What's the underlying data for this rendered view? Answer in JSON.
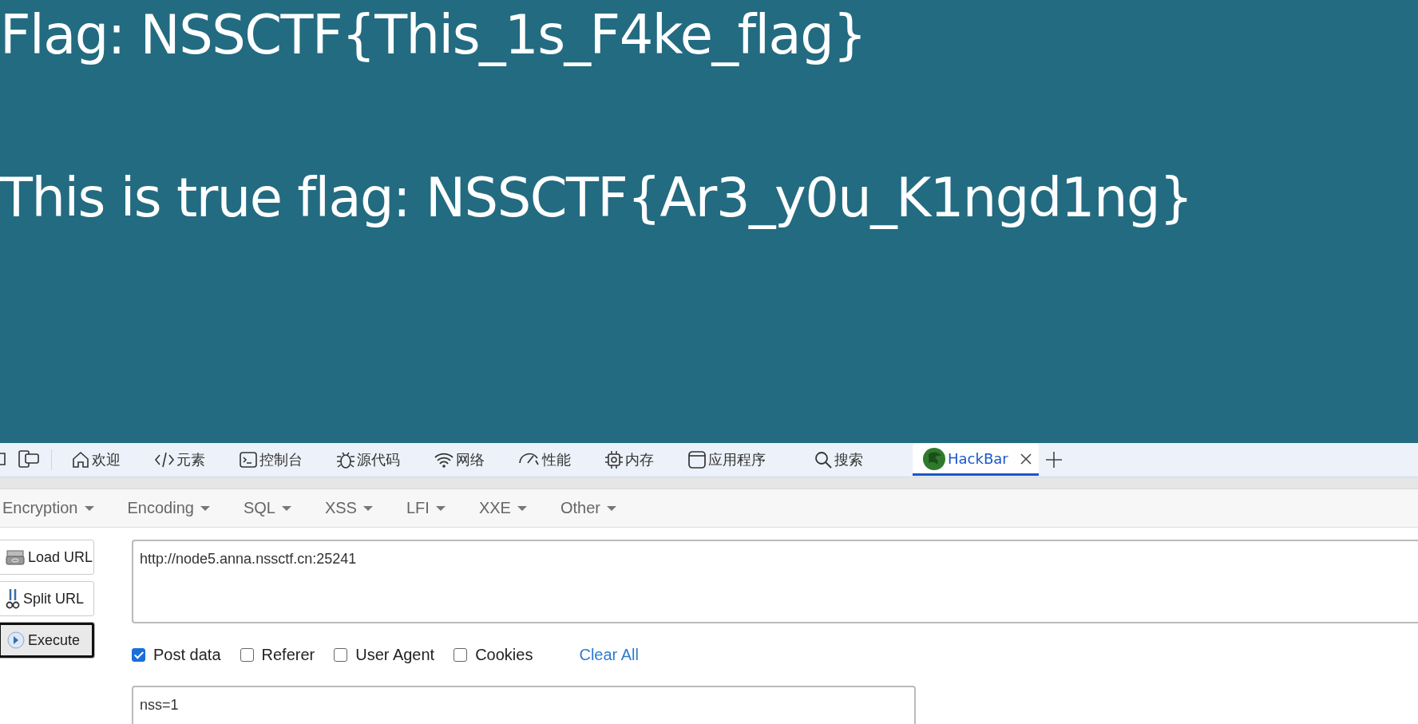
{
  "page": {
    "lines": [
      "Flag: NSSCTF{This_1s_F4ke_flag}",
      "This is true flag: NSSCTF{Ar3_y0u_K1ngd1ng}"
    ]
  },
  "devtools": {
    "tabs": [
      {
        "label": "欢迎",
        "selected": false
      },
      {
        "label": "元素",
        "selected": false
      },
      {
        "label": "控制台",
        "selected": false
      },
      {
        "label": "源代码",
        "selected": false
      },
      {
        "label": "网络",
        "selected": false
      },
      {
        "label": "性能",
        "selected": false
      },
      {
        "label": "内存",
        "selected": false
      },
      {
        "label": "应用程序",
        "selected": false
      },
      {
        "label": "搜索",
        "selected": false
      },
      {
        "label": "HackBar",
        "selected": true
      }
    ]
  },
  "hackbar": {
    "menus": [
      "Encryption",
      "Encoding",
      "SQL",
      "XSS",
      "LFI",
      "XXE",
      "Other"
    ],
    "buttons": [
      {
        "label": "Load URL",
        "focused": false
      },
      {
        "label": "Split URL",
        "focused": false
      },
      {
        "label": "Execute",
        "focused": true
      }
    ],
    "url": "http://node5.anna.nssctf.cn:25241",
    "options": [
      {
        "label": "Post data",
        "checked": true
      },
      {
        "label": "Referer",
        "checked": false
      },
      {
        "label": "User Agent",
        "checked": false
      },
      {
        "label": "Cookies",
        "checked": false
      }
    ],
    "clear_all": "Clear All",
    "post_data": "nss=1"
  }
}
